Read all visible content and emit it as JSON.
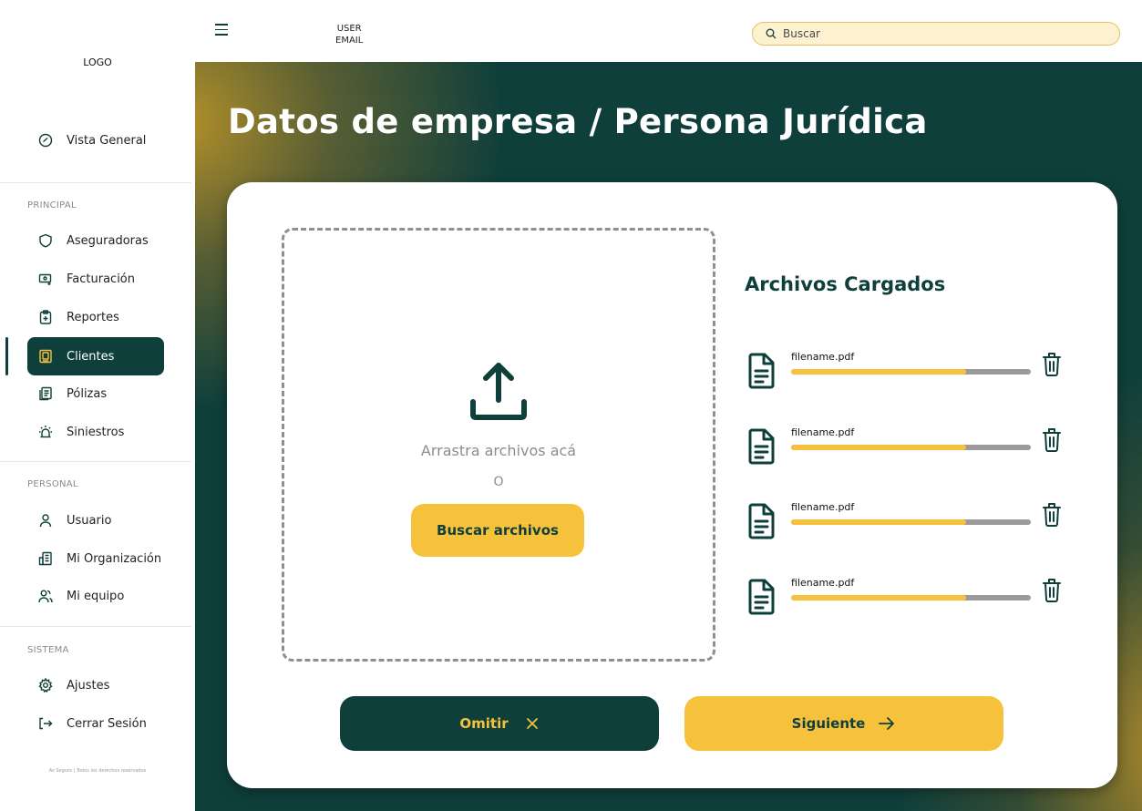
{
  "brand": {
    "logo_text": "LOGO",
    "footer": "Av Seguro | Todos los derechos reservados"
  },
  "sidebar": {
    "overview": "Vista General",
    "sections": [
      {
        "title": "PRINCIPAL",
        "items": [
          "Aseguradoras",
          "Facturación",
          "Reportes",
          "Clientes",
          "Pólizas",
          "Siniestros"
        ]
      },
      {
        "title": "PERSONAL",
        "items": [
          "Usuario",
          "Mi Organización",
          "Mi equipo"
        ]
      },
      {
        "title": "SISTEMA",
        "items": [
          "Ajustes",
          "Cerrar Sesión"
        ]
      }
    ],
    "active_item": "Clientes"
  },
  "topbar": {
    "user_line1": "USER",
    "user_line2": "EMAIL",
    "search_placeholder": "Buscar"
  },
  "main": {
    "title": "Datos de empresa / Persona Jurídica",
    "dropzone": {
      "text": "Arrastra archivos acá",
      "or": "O",
      "button": "Buscar archivos"
    },
    "files_title": "Archivos Cargados",
    "files": [
      {
        "name": "filename.pdf",
        "progress": 0.73
      },
      {
        "name": "filename.pdf",
        "progress": 0.73
      },
      {
        "name": "filename.pdf",
        "progress": 0.73
      },
      {
        "name": "filename.pdf",
        "progress": 0.73
      }
    ],
    "omit_button": "Omitir",
    "next_button": "Siguiente"
  },
  "colors": {
    "primary": "#0f3f3b",
    "accent": "#f6c23c",
    "progress_track": "#9b9b9b"
  }
}
